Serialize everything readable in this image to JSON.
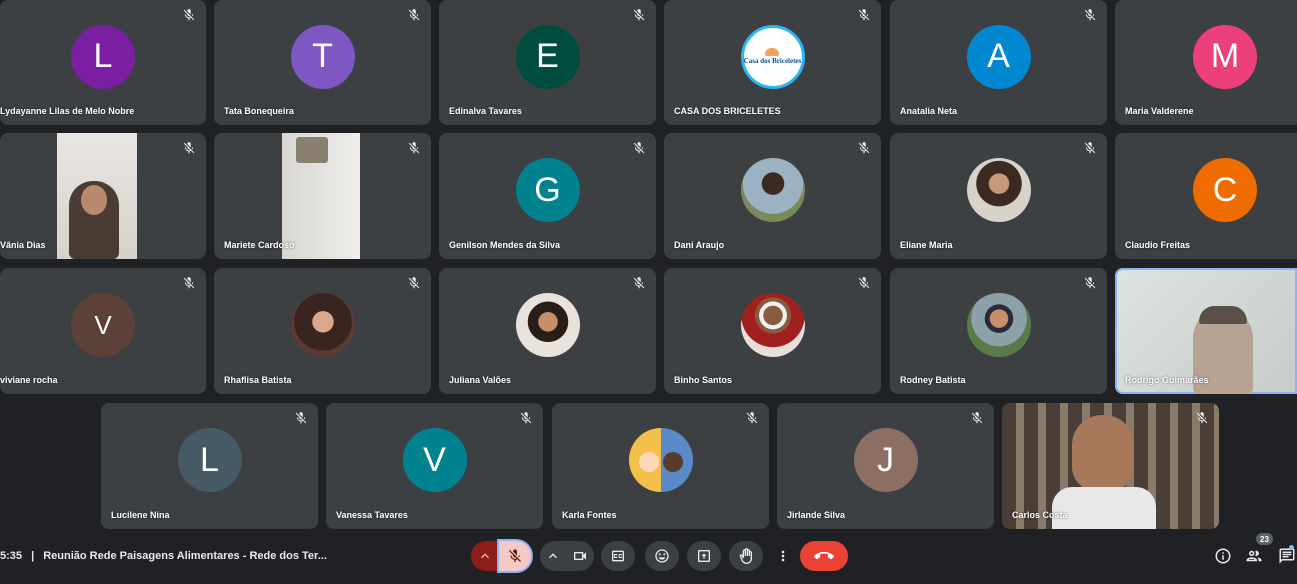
{
  "participants": [
    {
      "name": "Lydayanne Lilas de Melo Nobre",
      "initial": "L",
      "color": "#7b1fa2"
    },
    {
      "name": "Tata Bonequeira",
      "initial": "T",
      "color": "#7e57c2"
    },
    {
      "name": "Edinalva Tavares",
      "initial": "E",
      "color": "#004d40"
    },
    {
      "name": "CASA DOS BRICELETES",
      "initial": "",
      "color": "#29b6f6",
      "logo_text": "Casa dos Briceletes"
    },
    {
      "name": "Anatalia Neta",
      "initial": "A",
      "color": "#0288d1"
    },
    {
      "name": "Maria Valderene",
      "initial": "M",
      "color": "#ec407a"
    },
    {
      "name": "Vânia Dias",
      "initial": "",
      "color": "#6d5a4a"
    },
    {
      "name": "Mariete Cardoso",
      "initial": "",
      "color": "#c9c6c0"
    },
    {
      "name": "Genilson Mendes da Silva",
      "initial": "G",
      "color": "#00838f"
    },
    {
      "name": "Dani Araujo",
      "initial": "",
      "color": "#6b5d4d"
    },
    {
      "name": "Eliane Maria",
      "initial": "",
      "color": "#7a6a5a"
    },
    {
      "name": "Claudio Freitas",
      "initial": "C",
      "color": "#ef6c00"
    },
    {
      "name": "viviane rocha",
      "initial": "V",
      "color": "#5d4037"
    },
    {
      "name": "Rhaflisa Batista",
      "initial": "",
      "color": "#8a6a5a"
    },
    {
      "name": "Juliana Valões",
      "initial": "",
      "color": "#c8a88a"
    },
    {
      "name": "Binho Santos",
      "initial": "",
      "color": "#8a3030"
    },
    {
      "name": "Rodney Batista",
      "initial": "",
      "color": "#6f8a9a"
    },
    {
      "name": "Rodrigo Guimarães",
      "initial": "",
      "color": "#d8dcd8"
    },
    {
      "name": "Lucilene Nina",
      "initial": "L",
      "color": "#455a64"
    },
    {
      "name": "Vanessa Tavares",
      "initial": "V",
      "color": "#00838f"
    },
    {
      "name": "Karla Fontes",
      "initial": "",
      "color": "#f4c04a"
    },
    {
      "name": "Jirlande Silva",
      "initial": "J",
      "color": "#8d6e63"
    },
    {
      "name": "Carlos Costa",
      "initial": "",
      "color": "#5a5048"
    }
  ],
  "meeting": {
    "time": "5:35",
    "separator": "|",
    "title": "Reunião Rede Paisagens Alimentares - Rede dos Ter..."
  },
  "people_count": "23",
  "colors": {
    "background": "#202124",
    "tile": "#3c4043",
    "leave_button": "#ea4335",
    "mic_off_bg": "#f6c8c4",
    "active_border": "#8ab4f8"
  },
  "icons": {
    "mute": "mic-off-icon",
    "camera": "video-camera-icon",
    "captions": "closed-captions-icon",
    "emoji": "emoji-icon",
    "present": "present-screen-icon",
    "hand": "raise-hand-icon",
    "more": "more-vert-icon",
    "leave": "call-end-icon",
    "info": "info-icon",
    "people": "people-icon",
    "chat": "chat-icon"
  }
}
